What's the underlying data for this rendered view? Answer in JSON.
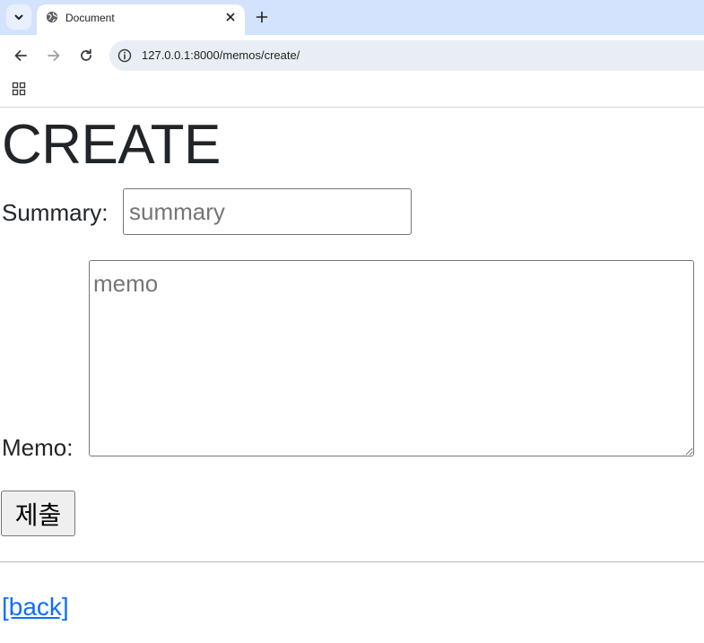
{
  "browser": {
    "tab": {
      "title": "Document"
    },
    "address_bar": {
      "url": "127.0.0.1:8000/memos/create/"
    },
    "icons": [
      "tab-list-icon",
      "globe-icon",
      "close-icon",
      "plus-icon",
      "back-arrow-icon",
      "forward-arrow-icon",
      "reload-icon",
      "site-info-icon",
      "apps-grid-icon"
    ]
  },
  "page": {
    "title": "CREATE",
    "form": {
      "summary_label": "Summary:",
      "summary_placeholder": "summary",
      "summary_value": "",
      "memo_label": "Memo:",
      "memo_placeholder": "memo",
      "memo_value": "",
      "submit_label": "제출"
    },
    "back_link": "[back]"
  },
  "colors": {
    "tabstrip_bg": "#d3e3fd",
    "omnibox_bg": "#e9eef6",
    "text": "#212529",
    "link": "#0d6efd"
  }
}
